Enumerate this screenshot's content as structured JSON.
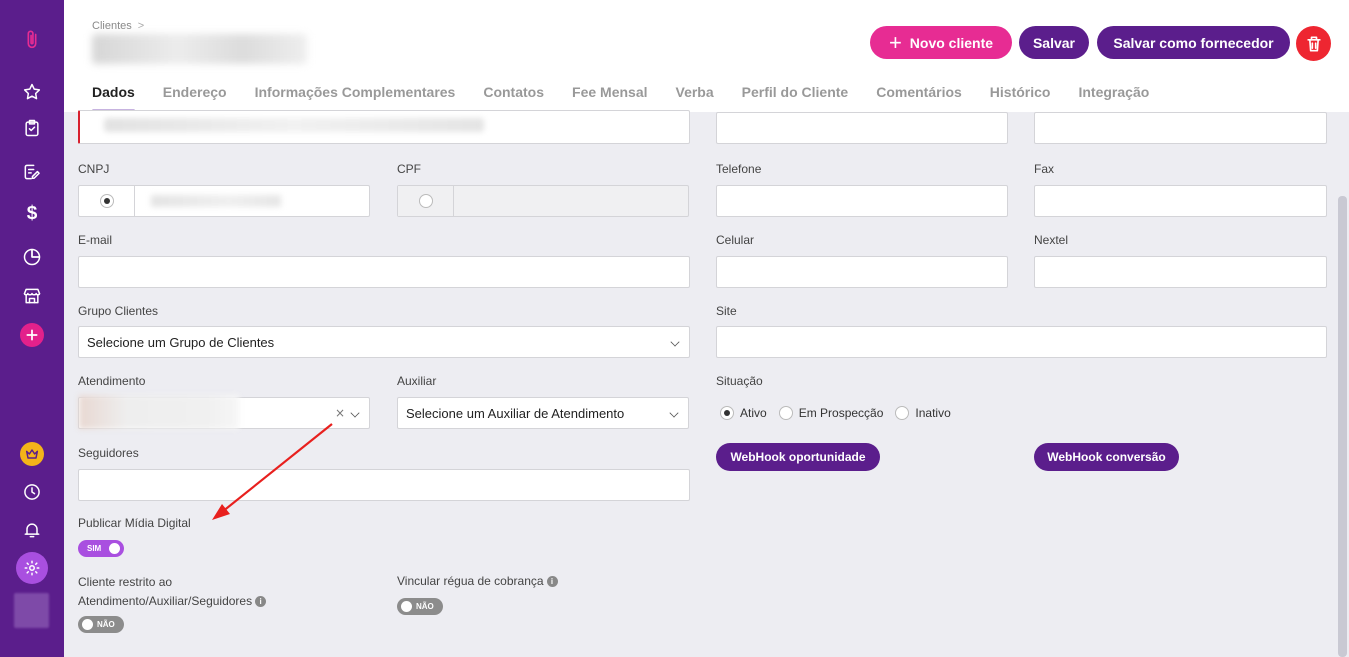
{
  "breadcrumb": {
    "root": "Clientes",
    "separator": ">"
  },
  "header": {
    "new_client": "Novo cliente",
    "save": "Salvar",
    "save_supplier": "Salvar como fornecedor"
  },
  "tabs": [
    {
      "label": "Dados"
    },
    {
      "label": "Endereço"
    },
    {
      "label": "Informações Complementares"
    },
    {
      "label": "Contatos"
    },
    {
      "label": "Fee Mensal"
    },
    {
      "label": "Verba"
    },
    {
      "label": "Perfil do Cliente"
    },
    {
      "label": "Comentários"
    },
    {
      "label": "Histórico"
    },
    {
      "label": "Integração"
    }
  ],
  "form": {
    "cnpj_label": "CNPJ",
    "cpf_label": "CPF",
    "telefone_label": "Telefone",
    "fax_label": "Fax",
    "email_label": "E-mail",
    "celular_label": "Celular",
    "nextel_label": "Nextel",
    "grupo_label": "Grupo Clientes",
    "grupo_value": "Selecione um Grupo de Clientes",
    "site_label": "Site",
    "atendimento_label": "Atendimento",
    "auxiliar_label": "Auxiliar",
    "auxiliar_value": "Selecione um Auxiliar de Atendimento",
    "situacao_label": "Situação",
    "situacao_options": [
      "Ativo",
      "Em Prospecção",
      "Inativo"
    ],
    "seguidores_label": "Seguidores",
    "webhook_oportunidade": "WebHook oportunidade",
    "webhook_conversao": "WebHook conversão",
    "publicar_label": "Publicar Mídia Digital",
    "publicar_toggle": "SIM",
    "restrito_label_1": "Cliente restrito ao",
    "restrito_label_2": "Atendimento/Auxiliar/Seguidores",
    "restrito_toggle": "NÃO",
    "regua_label": "Vincular régua de cobrança",
    "regua_toggle": "NÃO",
    "clear_mark": "×"
  },
  "colors": {
    "sidebar": "#5b1e8c",
    "accent_pink": "#e72c93",
    "danger": "#ee2631",
    "toggle_on": "#a94fe0",
    "annotation_arrow": "#e8201e"
  }
}
